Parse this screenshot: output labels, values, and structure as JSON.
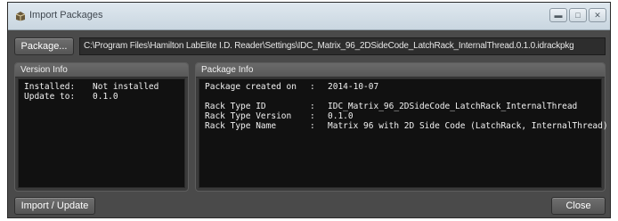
{
  "window": {
    "title": "Import Packages",
    "controls": [
      "minimize",
      "maximize",
      "close"
    ]
  },
  "package_bar": {
    "button_label": "Package...",
    "path": "C:\\Program Files\\Hamilton LabElite I.D. Reader\\Settings\\IDC_Matrix_96_2DSideCode_LatchRack_InternalThread.0.1.0.idrackpkg"
  },
  "version_info": {
    "header": "Version Info",
    "rows": [
      {
        "key": "Installed:",
        "value": "Not installed"
      },
      {
        "key": "Update to:",
        "value": "0.1.0"
      }
    ]
  },
  "package_info": {
    "header": "Package Info",
    "created": {
      "key": "Package created on",
      "value": "2014-10-07"
    },
    "rows": [
      {
        "key": "Rack Type ID",
        "value": "IDC_Matrix_96_2DSideCode_LatchRack_InternalThread"
      },
      {
        "key": "Rack Type Version",
        "value": "0.1.0"
      },
      {
        "key": "Rack Type Name",
        "value": "Matrix 96 with 2D Side Code (LatchRack, InternalThread)"
      }
    ],
    "separator": ":"
  },
  "footer": {
    "import_label": "Import / Update",
    "close_label": "Close"
  },
  "colors": {
    "window_bg": "#4a4a4a",
    "panel_bg": "#111111",
    "titlebar": "#c9d6e0"
  }
}
